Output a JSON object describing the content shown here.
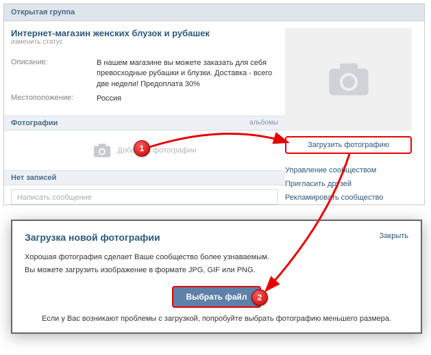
{
  "header": "Открытая группа",
  "group": {
    "title": "Интернет-магазин женских блузок и рубашек",
    "change_status": "изменить статус"
  },
  "info": {
    "desc_label": "Описание:",
    "desc_value": "В нашем магазине вы можете заказать для себя превосходные рубашки и блузки. Доставка - всего две недели! Предоплата 30%",
    "loc_label": "Местоположение:",
    "loc_value": "Россия"
  },
  "photos": {
    "title": "Фотографии",
    "albums": "альбомы",
    "add": "Добавить фотографии"
  },
  "empty_section": "Нет записей",
  "write_placeholder": "Написать сообщение",
  "right": {
    "upload": "Загрузить фотографию",
    "links": [
      "Управление сообществом",
      "Пригласить друзей",
      "Рекламировать сообщество"
    ]
  },
  "modal": {
    "title": "Загрузка новой фотографии",
    "close": "Закрыть",
    "line1": "Хорошая фотография сделает Ваше сообщество более узнаваемым.",
    "line2": "Вы можете загрузить изображение в формате JPG, GIF или PNG.",
    "choose": "Выбрать файл",
    "footer": "Если у Вас возникают проблемы с загрузкой, попробуйте выбрать фотографию меньшего размера."
  },
  "markers": {
    "one": "1",
    "two": "2"
  }
}
